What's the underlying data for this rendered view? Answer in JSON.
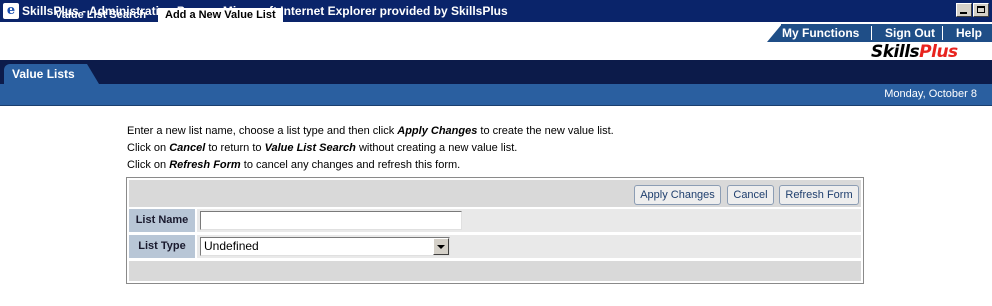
{
  "window": {
    "title": "SkillsPlus - Administration Pages - Microsoft Internet Explorer provided by SkillsPlus",
    "icon": "ie-icon"
  },
  "topnav": {
    "items": [
      "My Functions",
      "Sign Out",
      "Help"
    ]
  },
  "logo": {
    "part1": "Skills",
    "part2": "Plus"
  },
  "main_tab": {
    "label": "Value Lists"
  },
  "subnav": {
    "items": [
      "Value List Search",
      "Add a New Value List"
    ],
    "active_index": 1,
    "date": "Monday, October 8"
  },
  "instructions": {
    "line1": {
      "before": "Enter a new list name, choose a list type and then click ",
      "em": "Apply Changes",
      "after": " to create the new value list."
    },
    "line2": {
      "before": "Click on ",
      "em": "Cancel",
      "mid": " to return to ",
      "em2": "Value List Search",
      "after": " without creating a new value list."
    },
    "line3": {
      "before": "Click on ",
      "em": "Refresh Form",
      "after": " to cancel any changes and refresh this form."
    }
  },
  "form": {
    "buttons": {
      "apply": "Apply Changes",
      "cancel": "Cancel",
      "refresh": "Refresh Form"
    },
    "list_name": {
      "label": "List Name",
      "value": ""
    },
    "list_type": {
      "label": "List Type",
      "selected": "Undefined"
    }
  },
  "colors": {
    "titlebar": "#0a246a",
    "band": "#0c1b4a",
    "accent_blue": "#2a5fa0",
    "logo_red": "#e8231e"
  }
}
